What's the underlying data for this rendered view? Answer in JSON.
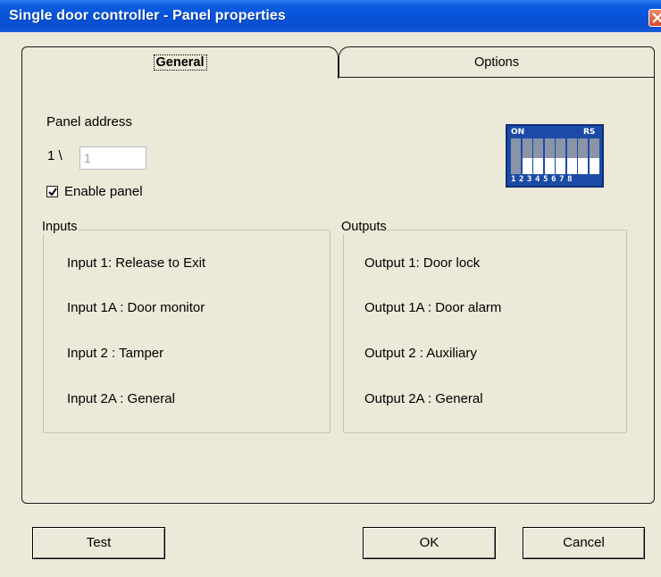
{
  "window": {
    "title": "Single door controller - Panel properties"
  },
  "tabs": [
    {
      "label": "General",
      "active": true
    },
    {
      "label": "Options",
      "active": false
    }
  ],
  "general": {
    "panel_address_label": "Panel address",
    "address_prefix": "1 \\",
    "address_value": "1",
    "enable_panel_label": "Enable panel",
    "enable_panel_checked": true
  },
  "dip_switch": {
    "on_label": "ON",
    "rs_label": "RS",
    "numbers": "12345678",
    "positions": [
      "on",
      "off",
      "off",
      "off",
      "off",
      "off",
      "off",
      "off"
    ]
  },
  "inputs": {
    "legend": "Inputs",
    "items": [
      "Input 1: Release to Exit",
      "Input 1A : Door monitor",
      "Input 2 : Tamper",
      "Input 2A : General"
    ]
  },
  "outputs": {
    "legend": "Outputs",
    "items": [
      "Output 1: Door lock",
      "Output 1A : Door alarm",
      "Output 2 : Auxiliary",
      "Output 2A : General"
    ]
  },
  "buttons": {
    "test": "Test",
    "ok": "OK",
    "cancel": "Cancel"
  },
  "colors": {
    "title_bar": "#0852d8",
    "dialog_bg": "#ece9d8",
    "dip_bg": "#1b4ba6"
  }
}
